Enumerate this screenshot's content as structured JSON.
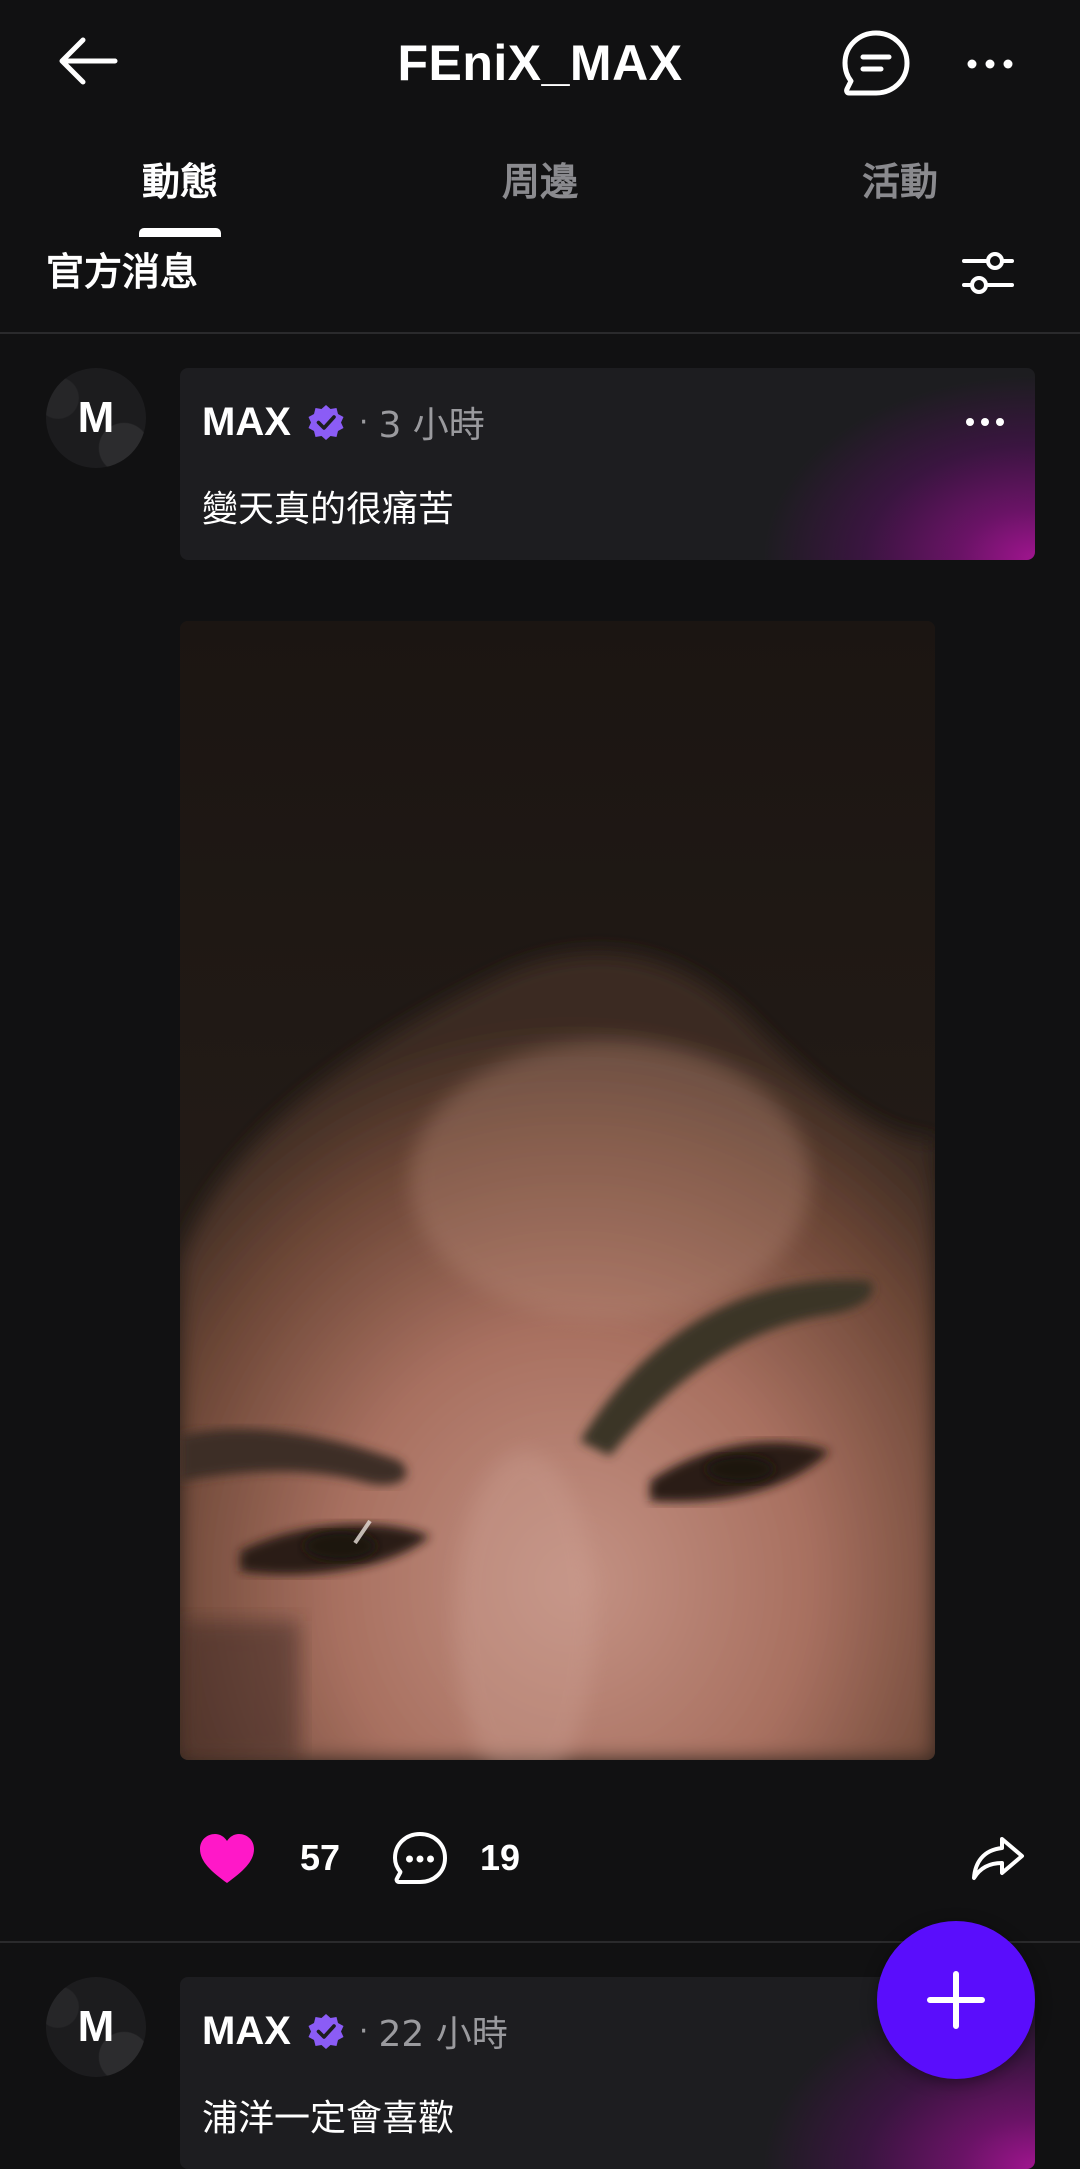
{
  "header": {
    "title": "FEniX_MAX"
  },
  "tabs": [
    {
      "label": "動態",
      "active": true
    },
    {
      "label": "周邊",
      "active": false
    },
    {
      "label": "活動",
      "active": false
    }
  ],
  "filter": {
    "section_label": "官方消息"
  },
  "posts": [
    {
      "avatar_letter": "M",
      "author": "MAX",
      "dot": "·",
      "time": "3 小時",
      "text": "變天真的很痛苦",
      "likes": "57",
      "comments": "19",
      "liked": true
    },
    {
      "avatar_letter": "M",
      "author": "MAX",
      "dot": "·",
      "time": "22 小時",
      "text": "浦洋一定會喜歡"
    }
  ],
  "colors": {
    "background": "#111112",
    "card": "#1d1d20",
    "accent_magenta": "#ff18c8",
    "verified_purple": "#8b5cf6",
    "fab": "#5a0dfc",
    "muted_text": "#9a9a9e"
  },
  "icons": {
    "back": "arrow-left-icon",
    "chat": "chat-bubble-icon",
    "more": "more-dots-icon",
    "filter": "sliders-icon",
    "verified": "verified-badge-icon",
    "like": "heart-icon",
    "comment": "comment-icon",
    "share": "share-arrow-icon",
    "fab": "plus-icon"
  }
}
